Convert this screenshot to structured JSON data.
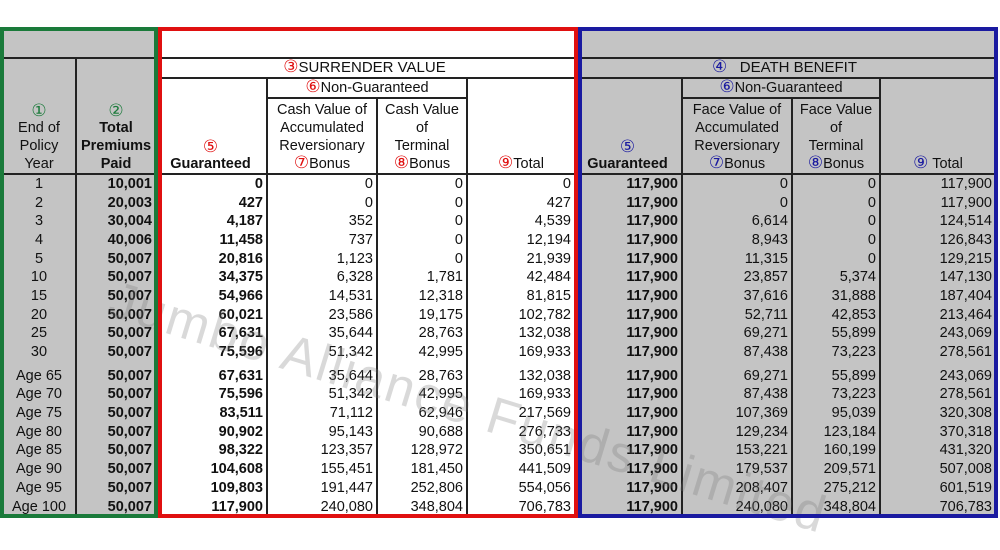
{
  "markers": {
    "m1": "①",
    "m2": "②",
    "m3": "③",
    "m4": "④",
    "m5": "⑤",
    "m6": "⑥",
    "m7": "⑦",
    "m8": "⑧",
    "m9": "⑨"
  },
  "headers": {
    "policy_year": [
      "End of",
      "Policy",
      "Year"
    ],
    "total_premiums": [
      "Total",
      "Premiums",
      "Paid"
    ],
    "surrender_value": "SURRENDER VALUE",
    "death_benefit": "DEATH BENEFIT",
    "non_guaranteed": "Non-Guaranteed",
    "guaranteed": "Guaranteed",
    "total": "Total",
    "sv_rev_bonus": [
      "Cash Value of",
      "Accumulated",
      "Reversionary",
      "Bonus"
    ],
    "sv_term_bonus": [
      "Cash Value",
      "of",
      "Terminal",
      "Bonus"
    ],
    "db_rev_bonus": [
      "Face Value of",
      "Accumulated",
      "Reversionary",
      "Bonus"
    ],
    "db_term_bonus": [
      "Face Value",
      "of",
      "Terminal",
      "Bonus"
    ]
  },
  "colors": {
    "premium_section": "#1a7a3a",
    "surrender_section": "#e01010",
    "death_section": "#1a1aa0",
    "gray_fill": "#c4c4c4"
  },
  "watermark": "Jumbo Alliance Funds Limited",
  "rows": [
    [
      "1",
      "10,001",
      "0",
      "0",
      "0",
      "0",
      "117,900",
      "0",
      "0",
      "117,900"
    ],
    [
      "2",
      "20,003",
      "427",
      "0",
      "0",
      "427",
      "117,900",
      "0",
      "0",
      "117,900"
    ],
    [
      "3",
      "30,004",
      "4,187",
      "352",
      "0",
      "4,539",
      "117,900",
      "6,614",
      "0",
      "124,514"
    ],
    [
      "4",
      "40,006",
      "11,458",
      "737",
      "0",
      "12,194",
      "117,900",
      "8,943",
      "0",
      "126,843"
    ],
    [
      "5",
      "50,007",
      "20,816",
      "1,123",
      "0",
      "21,939",
      "117,900",
      "11,315",
      "0",
      "129,215"
    ],
    [
      "10",
      "50,007",
      "34,375",
      "6,328",
      "1,781",
      "42,484",
      "117,900",
      "23,857",
      "5,374",
      "147,130"
    ],
    [
      "15",
      "50,007",
      "54,966",
      "14,531",
      "12,318",
      "81,815",
      "117,900",
      "37,616",
      "31,888",
      "187,404"
    ],
    [
      "20",
      "50,007",
      "60,021",
      "23,586",
      "19,175",
      "102,782",
      "117,900",
      "52,711",
      "42,853",
      "213,464"
    ],
    [
      "25",
      "50,007",
      "67,631",
      "35,644",
      "28,763",
      "132,038",
      "117,900",
      "69,271",
      "55,899",
      "243,069"
    ],
    [
      "30",
      "50,007",
      "75,596",
      "51,342",
      "42,995",
      "169,933",
      "117,900",
      "87,438",
      "73,223",
      "278,561"
    ]
  ],
  "age_rows": [
    [
      "Age 65",
      "50,007",
      "67,631",
      "35,644",
      "28,763",
      "132,038",
      "117,900",
      "69,271",
      "55,899",
      "243,069"
    ],
    [
      "Age 70",
      "50,007",
      "75,596",
      "51,342",
      "42,995",
      "169,933",
      "117,900",
      "87,438",
      "73,223",
      "278,561"
    ],
    [
      "Age 75",
      "50,007",
      "83,511",
      "71,112",
      "62,946",
      "217,569",
      "117,900",
      "107,369",
      "95,039",
      "320,308"
    ],
    [
      "Age 80",
      "50,007",
      "90,902",
      "95,143",
      "90,688",
      "276,733",
      "117,900",
      "129,234",
      "123,184",
      "370,318"
    ],
    [
      "Age 85",
      "50,007",
      "98,322",
      "123,357",
      "128,972",
      "350,651",
      "117,900",
      "153,221",
      "160,199",
      "431,320"
    ],
    [
      "Age 90",
      "50,007",
      "104,608",
      "155,451",
      "181,450",
      "441,509",
      "117,900",
      "179,537",
      "209,571",
      "507,008"
    ],
    [
      "Age 95",
      "50,007",
      "109,803",
      "191,447",
      "252,806",
      "554,056",
      "117,900",
      "208,407",
      "275,212",
      "601,519"
    ],
    [
      "Age 100",
      "50,007",
      "117,900",
      "240,080",
      "348,804",
      "706,783",
      "117,900",
      "240,080",
      "348,804",
      "706,783"
    ]
  ]
}
